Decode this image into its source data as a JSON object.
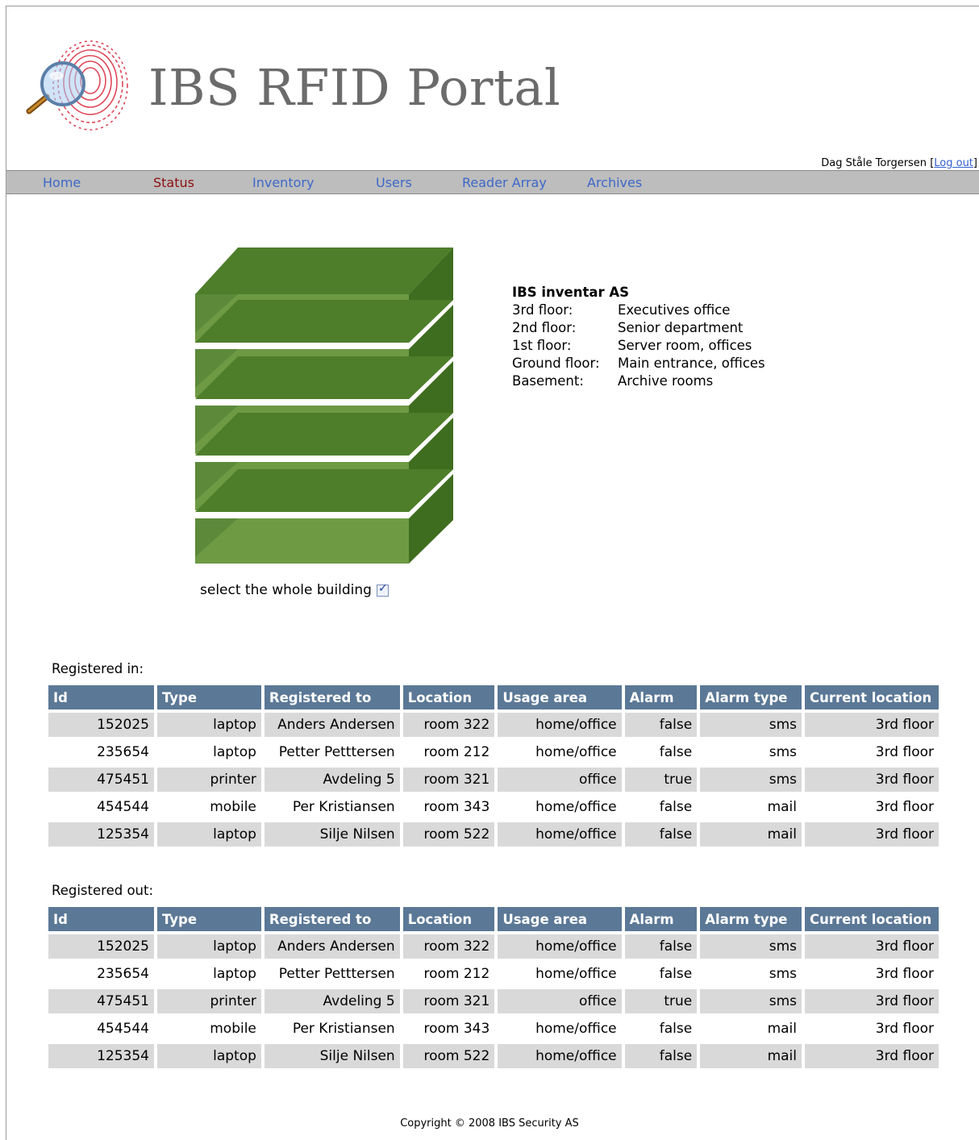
{
  "header": {
    "title": "IBS RFID Portal",
    "user_name": "Dag Ståle Torgersen",
    "logout_label": "Log out"
  },
  "nav": {
    "items": [
      {
        "label": "Home"
      },
      {
        "label": "Status"
      },
      {
        "label": "Inventory"
      },
      {
        "label": "Users"
      },
      {
        "label": "Reader Array"
      },
      {
        "label": "Archives"
      }
    ],
    "active": "Status"
  },
  "building": {
    "company": "IBS inventar AS",
    "floors": [
      {
        "name": "3rd floor:",
        "desc": "Executives office"
      },
      {
        "name": "2nd floor:",
        "desc": "Senior department"
      },
      {
        "name": "1st floor:",
        "desc": "Server room, offices"
      },
      {
        "name": "Ground floor:",
        "desc": "Main entrance, offices"
      },
      {
        "name": "Basement:",
        "desc": "Archive rooms"
      }
    ],
    "select_whole_label": "select the whole building",
    "select_whole_checked": true
  },
  "columns": [
    "Id",
    "Type",
    "Registered to",
    "Location",
    "Usage area",
    "Alarm",
    "Alarm type",
    "Current location"
  ],
  "registered_in": {
    "label": "Registered in:",
    "rows": [
      [
        "152025",
        "laptop",
        "Anders Andersen",
        "room 322",
        "home/office",
        "false",
        "sms",
        "3rd floor"
      ],
      [
        "235654",
        "laptop",
        "Petter Petttersen",
        "room 212",
        "home/office",
        "false",
        "sms",
        "3rd floor"
      ],
      [
        "475451",
        "printer",
        "Avdeling 5",
        "room 321",
        "office",
        "true",
        "sms",
        "3rd floor"
      ],
      [
        "454544",
        "mobile",
        "Per Kristiansen",
        "room 343",
        "home/office",
        "false",
        "mail",
        "3rd floor"
      ],
      [
        "125354",
        "laptop",
        "Silje Nilsen",
        "room 522",
        "home/office",
        "false",
        "mail",
        "3rd floor"
      ]
    ]
  },
  "registered_out": {
    "label": "Registered out:",
    "rows": [
      [
        "152025",
        "laptop",
        "Anders Andersen",
        "room 322",
        "home/office",
        "false",
        "sms",
        "3rd floor"
      ],
      [
        "235654",
        "laptop",
        "Petter Petttersen",
        "room 212",
        "home/office",
        "false",
        "sms",
        "3rd floor"
      ],
      [
        "475451",
        "printer",
        "Avdeling 5",
        "room 321",
        "office",
        "true",
        "sms",
        "3rd floor"
      ],
      [
        "454544",
        "mobile",
        "Per Kristiansen",
        "room 343",
        "home/office",
        "false",
        "mail",
        "3rd floor"
      ],
      [
        "125354",
        "laptop",
        "Silje Nilsen",
        "room 522",
        "home/office",
        "false",
        "mail",
        "3rd floor"
      ]
    ]
  },
  "footer": {
    "copyright": "Copyright © 2008 IBS Security AS"
  },
  "colors": {
    "nav_link": "#3d68c8",
    "nav_active": "#8e1010",
    "table_header": "#5b7896",
    "row_shade": "#d9d9d9",
    "floor_green": "#6e9a44"
  }
}
